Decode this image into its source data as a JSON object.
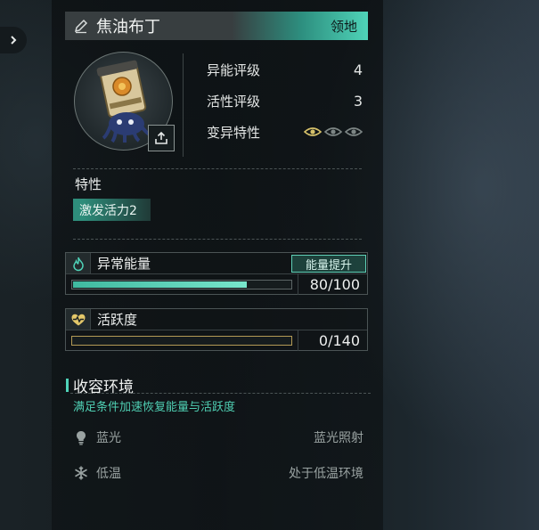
{
  "header": {
    "name": "焦油布丁",
    "territory_label": "领地"
  },
  "stats": [
    {
      "label": "异能评级",
      "value": "4"
    },
    {
      "label": "活性评级",
      "value": "3"
    }
  ],
  "mutation": {
    "label": "变异特性",
    "active_count": 1,
    "total": 3
  },
  "traits": {
    "title": "特性",
    "items": [
      "激发活力2"
    ]
  },
  "energy": {
    "title": "异常能量",
    "boost_label": "能量提升",
    "current": 80,
    "max": 100,
    "text": "80/100"
  },
  "activity": {
    "title": "活跃度",
    "current": 0,
    "max": 140,
    "text": "0/140"
  },
  "containment": {
    "title": "收容环境",
    "subtitle": "满足条件加速恢复能量与活跃度",
    "rows": [
      {
        "icon": "lightbulb-icon",
        "name": "蓝光",
        "condition": "蓝光照射"
      },
      {
        "icon": "snowflake-icon",
        "name": "低温",
        "condition": "处于低温环境"
      }
    ]
  },
  "colors": {
    "accent": "#4fd3b8",
    "gold": "#b39a55",
    "eye_active": "#d6c16a",
    "eye_inactive": "#7d8685"
  }
}
